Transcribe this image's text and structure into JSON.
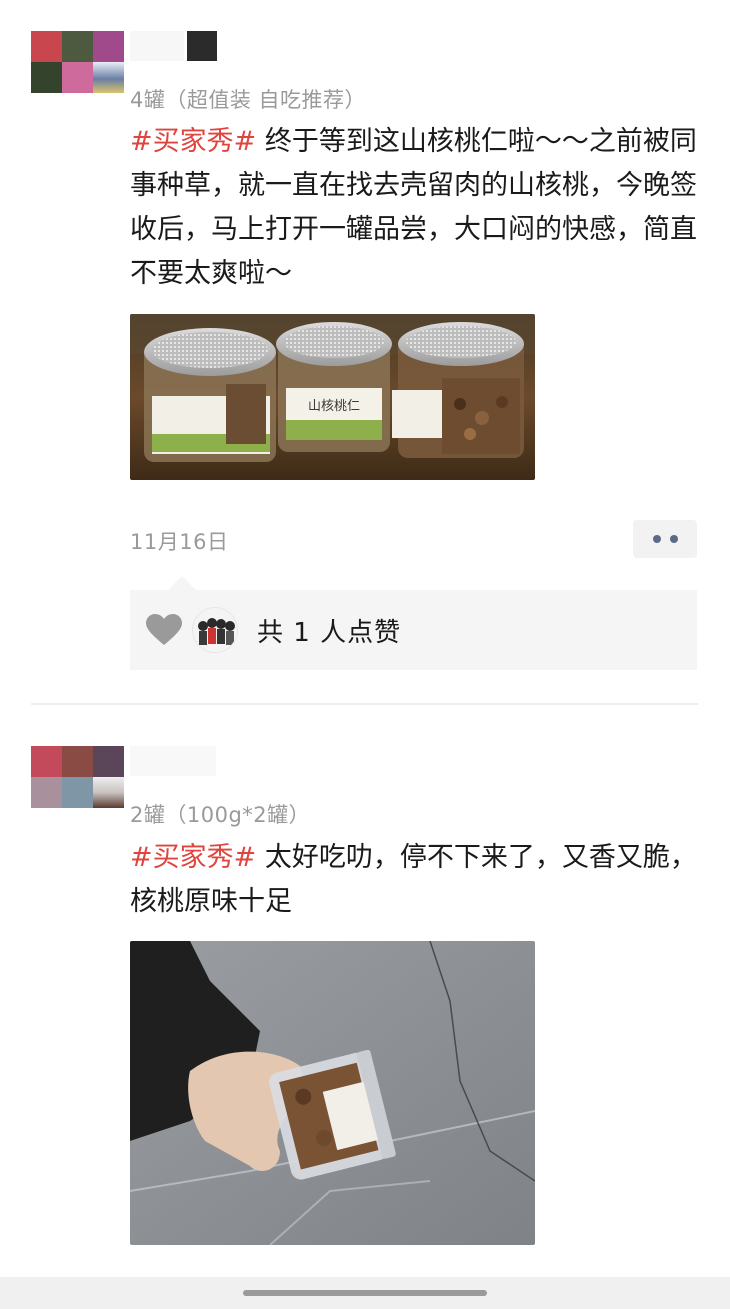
{
  "posts": [
    {
      "spec": "4罐（超值装 自吃推荐）",
      "tag": "#买家秀#",
      "text": " 终于等到这山核桃仁啦～～之前被同事种草，就一直在找去壳留肉的山核桃，今晚签收后，马上打开一罐品尝，大口闷的快感，简直不要太爽啦～",
      "photo": {
        "jar_labels": [
          "",
          "山核桃仁",
          ""
        ]
      },
      "date": "11月16日",
      "likes_text": "共 1 人点赞"
    },
    {
      "spec": "2罐（100g*2罐）",
      "tag": "#买家秀#",
      "text": " 太好吃叻，停不下来了，又香又脆，核桃原味十足"
    }
  ],
  "icons": {
    "more": "more-dots-icon",
    "like": "heart-icon"
  },
  "colors": {
    "tag": "#e0443e",
    "muted": "#9a9a9a",
    "more_dots": "#5b6a86",
    "likes_bg": "#f5f5f5"
  }
}
